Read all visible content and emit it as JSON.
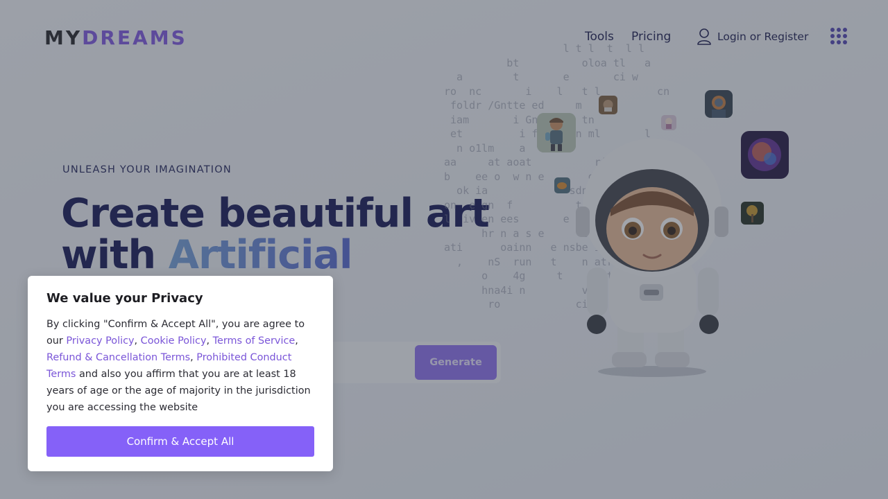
{
  "header": {
    "logo_part1": "MY",
    "logo_part2": "DREAMS",
    "nav_tools": "Tools",
    "nav_pricing": "Pricing",
    "login_label": "Login or Register"
  },
  "hero": {
    "eyebrow": "UNLEASH YOUR IMAGINATION",
    "headline_line1": "Create beautiful art",
    "headline_line2_prefix": "with ",
    "headline_line2_accent": "Artificial",
    "generate_label": "Generate"
  },
  "privacy_modal": {
    "title": "We value your Privacy",
    "intro": "By clicking \"Confirm & Accept All\", you are agree to our ",
    "link_privacy": "Privacy Policy",
    "sep1": ", ",
    "link_cookie": "Cookie Policy",
    "sep2": ", ",
    "link_terms": "Terms of Service",
    "sep3": ", ",
    "link_refund": "Refund & Cancellation Terms",
    "sep4": ", ",
    "link_prohibited": "Prohibited Conduct Terms",
    "outro": " and also you affirm that you are at least 18 years of age or the age of majority in the jurisdiction you are accessing the website",
    "accept_label": "Confirm & Accept All"
  },
  "colors": {
    "brand_purple": "#8561f8",
    "headline_navy": "#0c0f4f",
    "overlay": "rgba(60,66,80,0.48)"
  },
  "icons": [
    "user-icon",
    "apps-grid-icon"
  ]
}
